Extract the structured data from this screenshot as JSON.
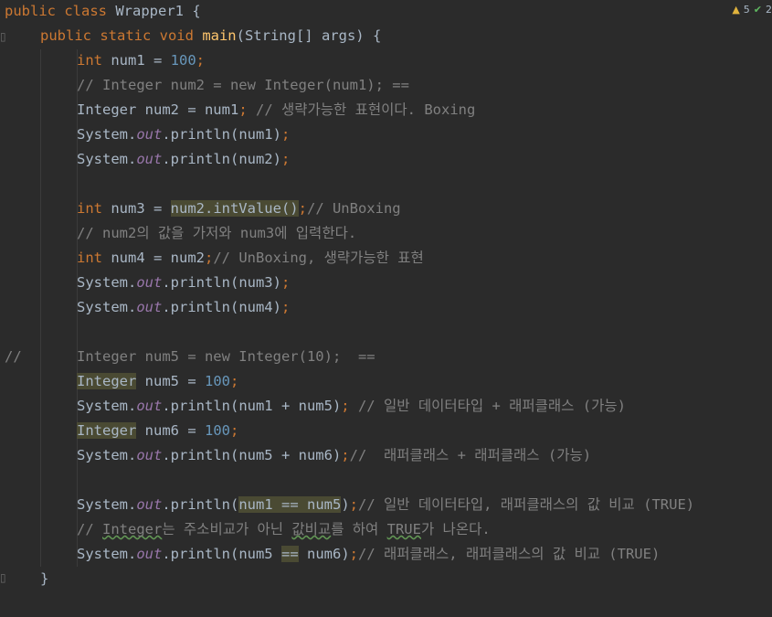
{
  "inspections": {
    "warnings": "5",
    "ok": "2"
  },
  "code": {
    "class_kw": "public class",
    "class_name": "Wrapper1 {",
    "main_sig": [
      "public static void ",
      "main",
      "(String[] args) {"
    ],
    "l3": [
      "int ",
      "num1 = ",
      "100",
      ";"
    ],
    "l4": "// Integer num2 = new Integer(num1); ==",
    "l5": [
      "Integer num2 = num1",
      ";",
      " // 생략가능한 표현이다. Boxing"
    ],
    "println": "System.",
    "out": "out",
    "println_num1": ".println(num1)",
    "println_num2": ".println(num2)",
    "semi": ";",
    "l9": [
      "int ",
      "num3 = ",
      "num2.intValue()",
      ";",
      "// UnBoxing"
    ],
    "l10": "// num2의 값을 가저와 num3에 입력한다.",
    "l11": [
      "int ",
      "num4 = num2",
      ";",
      "// UnBoxing, 생략가능한 표현"
    ],
    "println_num3": ".println(num3)",
    "println_num4": ".println(num4)",
    "l15_prefix": "//",
    "l15": "Integer num5 = new Integer(10);  ==",
    "l16": [
      "Integer",
      " num5 = ",
      "100",
      ";"
    ],
    "l17": [
      ".println(num1 + num5)",
      ";",
      " // 일반 데이터타입 + 래퍼클래스 (가능)"
    ],
    "l18": [
      "Integer",
      " num6 = ",
      "100",
      ";"
    ],
    "l19": [
      ".println(num5 + num6)",
      ";",
      "//  래퍼클래스 + 래퍼클래스 (가능)"
    ],
    "l21": [
      ".println(",
      "num1 == num5",
      ")",
      ";",
      "// 일반 데이터타입, 래퍼클래스의 값 비교 (TRUE)"
    ],
    "l22": [
      "// ",
      "Integer",
      "는 주소비교가 아닌 ",
      "값비교",
      "를 하여 ",
      "TRUE",
      "가 나온다."
    ],
    "l23": [
      ".println(num5 ",
      "==",
      " num6)",
      ";",
      "// 래퍼클래스, 래퍼클래스의 값 비교 (TRUE)"
    ],
    "close_main": "}"
  }
}
